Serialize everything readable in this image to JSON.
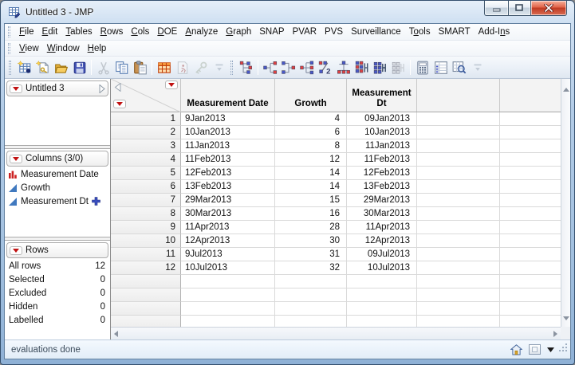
{
  "window": {
    "title": "Untitled 3 - JMP"
  },
  "menus": {
    "main": [
      {
        "label": "File",
        "u": 0
      },
      {
        "label": "Edit",
        "u": 0
      },
      {
        "label": "Tables",
        "u": 0
      },
      {
        "label": "Rows",
        "u": 0
      },
      {
        "label": "Cols",
        "u": 0
      },
      {
        "label": "DOE",
        "u": 0
      },
      {
        "label": "Analyze",
        "u": 0
      },
      {
        "label": "Graph",
        "u": 0
      },
      {
        "label": "SNAP",
        "u": -1
      },
      {
        "label": "PVAR",
        "u": -1
      },
      {
        "label": "PVS",
        "u": -1
      },
      {
        "label": "Surveillance",
        "u": -1
      },
      {
        "label": "Tools",
        "u": 1
      },
      {
        "label": "SMART",
        "u": -1
      },
      {
        "label": "Add-Ins",
        "u": 5
      }
    ],
    "secondary": [
      {
        "label": "View",
        "u": 0
      },
      {
        "label": "Window",
        "u": 0
      },
      {
        "label": "Help",
        "u": 0
      }
    ]
  },
  "toolbar": {
    "groups": [
      {
        "items": [
          {
            "icon": "new-data-table-icon"
          },
          {
            "icon": "new-script-icon"
          },
          {
            "icon": "open-icon"
          },
          {
            "icon": "save-icon"
          },
          {
            "sep": true
          },
          {
            "icon": "cut-icon",
            "disabled": true
          },
          {
            "icon": "copy-icon"
          },
          {
            "icon": "paste-icon"
          },
          {
            "sep": true
          },
          {
            "icon": "data-table-icon"
          },
          {
            "icon": "run-script-icon",
            "disabled": true
          },
          {
            "icon": "script-key-icon",
            "disabled": true
          },
          {
            "icon": "toolbar-overflow-icon",
            "disabled": true
          }
        ]
      },
      {
        "items": [
          {
            "icon": "distribution-icon"
          },
          {
            "sep": true
          },
          {
            "icon": "fit-y-by-x-icon"
          },
          {
            "icon": "matched-pairs-icon"
          },
          {
            "icon": "fit-model-icon"
          },
          {
            "icon": "modeling-icon"
          },
          {
            "icon": "screening-icon"
          },
          {
            "icon": "multivariate-icon"
          },
          {
            "icon": "reliability-icon"
          },
          {
            "icon": "platform-disabled-icon",
            "disabled": true
          },
          {
            "sep": true
          },
          {
            "icon": "formula-calculator-icon"
          },
          {
            "icon": "column-info-icon"
          },
          {
            "icon": "search-table-icon"
          },
          {
            "icon": "toolbar-overflow-icon",
            "disabled": true
          }
        ]
      }
    ]
  },
  "sidebar": {
    "table_panel": {
      "title": "Untitled 3"
    },
    "columns_panel": {
      "title": "Columns (3/0)",
      "items": [
        {
          "label": "Measurement Date",
          "type": "nominal",
          "formula": false
        },
        {
          "label": "Growth",
          "type": "continuous",
          "formula": false
        },
        {
          "label": "Measurement Dt",
          "type": "continuous",
          "formula": true
        }
      ]
    },
    "rows_panel": {
      "title": "Rows",
      "stats": [
        {
          "label": "All rows",
          "value": "12"
        },
        {
          "label": "Selected",
          "value": "0"
        },
        {
          "label": "Excluded",
          "value": "0"
        },
        {
          "label": "Hidden",
          "value": "0"
        },
        {
          "label": "Labelled",
          "value": "0"
        }
      ]
    }
  },
  "grid": {
    "columns": [
      "Measurement Date",
      "Growth",
      "Measurement Dt",
      "",
      ""
    ],
    "rows": [
      {
        "n": "1",
        "cells": [
          "9Jan2013",
          "4",
          "09Jan2013",
          "",
          ""
        ]
      },
      {
        "n": "2",
        "cells": [
          "10Jan2013",
          "6",
          "10Jan2013",
          "",
          ""
        ]
      },
      {
        "n": "3",
        "cells": [
          "11Jan2013",
          "8",
          "11Jan2013",
          "",
          ""
        ]
      },
      {
        "n": "4",
        "cells": [
          "11Feb2013",
          "12",
          "11Feb2013",
          "",
          ""
        ]
      },
      {
        "n": "5",
        "cells": [
          "12Feb2013",
          "14",
          "12Feb2013",
          "",
          ""
        ]
      },
      {
        "n": "6",
        "cells": [
          "13Feb2013",
          "14",
          "13Feb2013",
          "",
          ""
        ]
      },
      {
        "n": "7",
        "cells": [
          "29Mar2013",
          "15",
          "29Mar2013",
          "",
          ""
        ]
      },
      {
        "n": "8",
        "cells": [
          "30Mar2013",
          "16",
          "30Mar2013",
          "",
          ""
        ]
      },
      {
        "n": "9",
        "cells": [
          "11Apr2013",
          "28",
          "11Apr2013",
          "",
          ""
        ]
      },
      {
        "n": "10",
        "cells": [
          "12Apr2013",
          "30",
          "12Apr2013",
          "",
          ""
        ]
      },
      {
        "n": "11",
        "cells": [
          "9Jul2013",
          "31",
          "09Jul2013",
          "",
          ""
        ]
      },
      {
        "n": "12",
        "cells": [
          "10Jul2013",
          "32",
          "10Jul2013",
          "",
          ""
        ]
      }
    ]
  },
  "statusbar": {
    "text": "evaluations done"
  }
}
